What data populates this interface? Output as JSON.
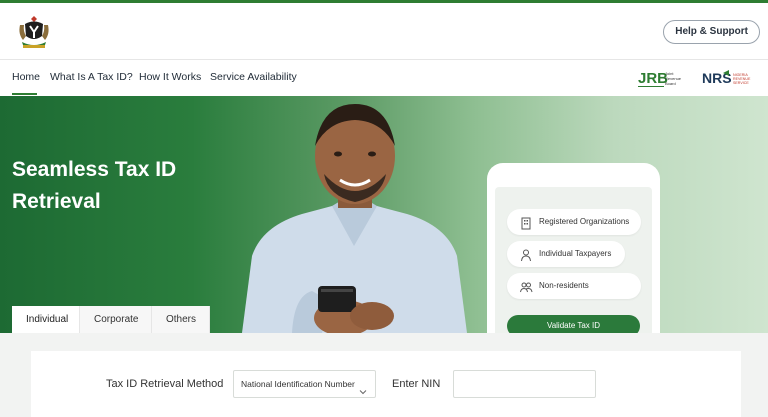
{
  "header": {
    "logo_icon": "nigeria-coat-of-arms-icon",
    "help_label": "Help & Support"
  },
  "nav": {
    "items": [
      {
        "label": "Home"
      },
      {
        "label": "What Is A Tax ID?"
      },
      {
        "label": "How It Works"
      },
      {
        "label": "Service Availability"
      }
    ],
    "partner_logos": [
      {
        "icon": "jrb-logo",
        "text": "JRB",
        "subtext": "Joint Revenue Board"
      },
      {
        "icon": "nrs-logo",
        "text": "NRS",
        "subtext": "NIGERIA REVENUE SERVICE"
      }
    ]
  },
  "hero": {
    "title": "Seamless Tax ID Retrieval",
    "phone": {
      "options": [
        {
          "label": "Registered Organizations",
          "icon": "building-icon"
        },
        {
          "label": "Individual Taxpayers",
          "icon": "person-icon"
        },
        {
          "label": "Non-residents",
          "icon": "group-icon"
        }
      ],
      "cta_label": "Validate Tax ID"
    }
  },
  "tabs": [
    {
      "label": "Individual",
      "active": true
    },
    {
      "label": "Corporate",
      "active": false
    },
    {
      "label": "Others",
      "active": false
    }
  ],
  "form": {
    "method_label": "Tax ID Retrieval Method",
    "method_value": "National Identification Number",
    "nin_label": "Enter NIN",
    "nin_value": "",
    "nin_placeholder": ""
  },
  "colors": {
    "brand_green": "#2e7d32",
    "button_green": "#2b7a3b"
  }
}
